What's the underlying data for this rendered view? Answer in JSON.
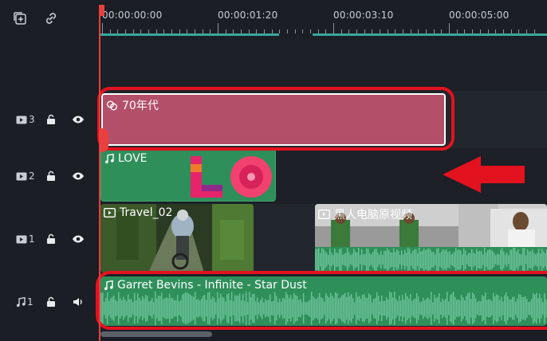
{
  "toolbar": {
    "add_track_icon": "add-track-icon",
    "link_icon": "link-icon"
  },
  "ruler": {
    "timecodes": [
      "00:00:00:00",
      "00:00:01:20",
      "00:00:03:10",
      "00:00:05:00"
    ]
  },
  "tracks": [
    {
      "kind": "video",
      "number": "3"
    },
    {
      "kind": "video",
      "number": "2"
    },
    {
      "kind": "video",
      "number": "1"
    },
    {
      "kind": "audio",
      "number": "1"
    }
  ],
  "clips": {
    "effect": {
      "title": "70年代"
    },
    "title_clip": {
      "title": "LOVE"
    },
    "video1": {
      "title": "Travel_02"
    },
    "video2": {
      "title": "黑人电脑原视频"
    },
    "audio": {
      "title": "Garret Bevins - Infinite - Star Dust"
    }
  },
  "colors": {
    "accent_red": "#e3121f",
    "effect_clip": "#b34f68",
    "media_clip": "#2f8f5b",
    "ruler_bar": "#3aa8a0"
  }
}
